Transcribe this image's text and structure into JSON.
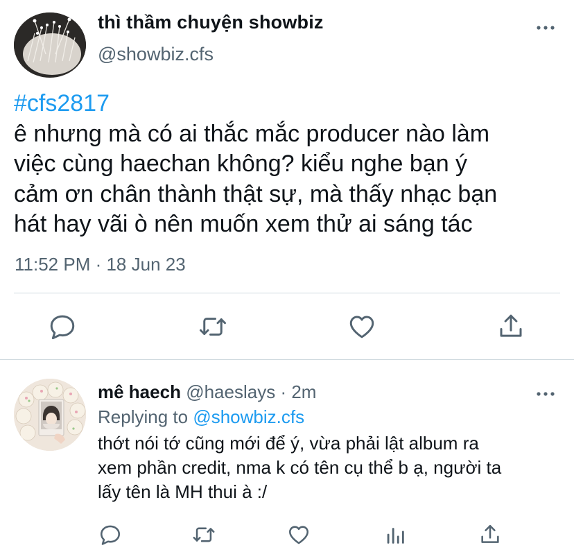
{
  "tweet": {
    "author_name": "thì thầm chuyện showbiz",
    "author_handle": "@showbiz.cfs",
    "hashtag": "#cfs2817",
    "lines": [
      "ê nhưng mà có ai thắc mắc producer nào làm",
      "việc cùng haechan không? kiểu nghe bạn ý",
      "cảm ơn chân thành thật sự, mà thấy nhạc bạn",
      "hát hay vãi ò nên muốn xem thử ai sáng tác"
    ],
    "timestamp": "11:52 PM · 18 Jun 23",
    "actions": [
      "reply-icon",
      "retweet-icon",
      "like-icon",
      "share-icon"
    ]
  },
  "reply": {
    "author_name": "mê haech",
    "author_handle": "@haeslays",
    "separator": "·",
    "time": "2m",
    "replying_prefix": "Replying to",
    "replying_to": "@showbiz.cfs",
    "lines": [
      "thớt nói tớ cũng mới để ý, vừa phải lật album ra",
      "xem phần credit, nma k có tên cụ thể b ạ, người ta",
      "lấy tên là MH thui à :/"
    ],
    "actions": [
      "reply-icon",
      "retweet-icon",
      "like-icon",
      "analytics-icon",
      "share-icon"
    ]
  },
  "colors": {
    "text": "#0f1419",
    "secondary": "#536471",
    "accent": "#1d9bf0",
    "divider": "#cfd9de"
  }
}
